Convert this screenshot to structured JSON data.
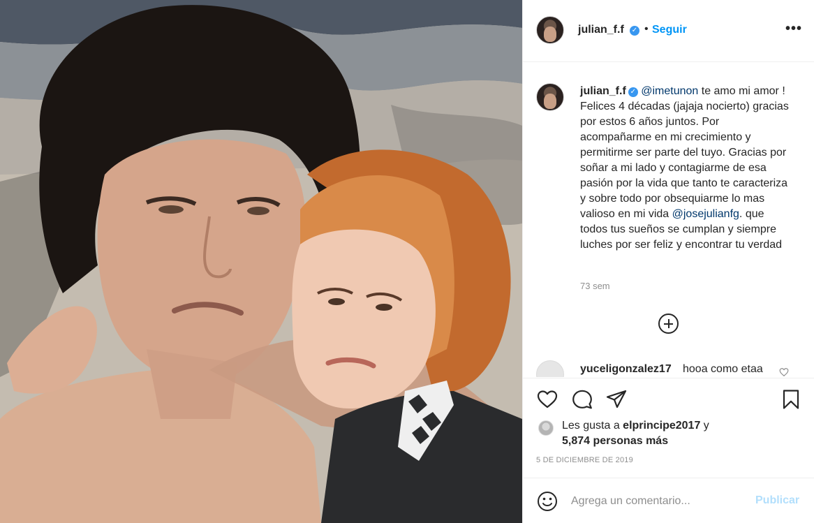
{
  "post": {
    "photo_alt": "",
    "header": {
      "username": "julian_f.f",
      "separator": "•",
      "follow_label": "Seguir",
      "more_label": "•••"
    },
    "caption": {
      "username": "julian_f.f",
      "mention_1": "@imetunon",
      "text_1": " te amo mi amor ! Felices 4 décadas (jajaja nocierto) gracias por estos 6 años juntos. Por acompañarme en mi crecimiento y permitirme ser parte del tuyo. Gracias por soñar a mi lado y contagiarme de esa pasión por la vida que tanto te caracteriza y sobre todo por obsequiarme lo mas valioso en mi vida ",
      "mention_2": "@josejulianfg",
      "text_2": ". que todos tus sueños se cumplan y siempre luches por ser feliz y encontrar tu verdad",
      "time_ago": "73 sem"
    },
    "comments": [
      {
        "username": "yuceligonzalez17",
        "text": "hooa como etaa"
      }
    ],
    "icons": {
      "like": "heart-outline-icon",
      "comment": "speech-bubble-icon",
      "share": "paper-plane-icon",
      "save": "bookmark-icon",
      "load_more": "plus-circle-icon",
      "emoji": "smiley-icon",
      "verified": "verified-badge-icon"
    },
    "likes": {
      "prefix": "Les gusta a ",
      "liker": "elprincipe2017",
      "middle": " y",
      "count_text": "5,874 personas más"
    },
    "date": "5 DE DICIEMBRE DE 2019",
    "composer": {
      "placeholder": "Agrega un comentario...",
      "publish_label": "Publicar"
    },
    "colors": {
      "link_blue": "#0095f6",
      "mention_blue": "#00376b",
      "muted": "#8e8e8e",
      "publish_disabled": "#b2dffc",
      "verified": "#3897f0"
    }
  }
}
